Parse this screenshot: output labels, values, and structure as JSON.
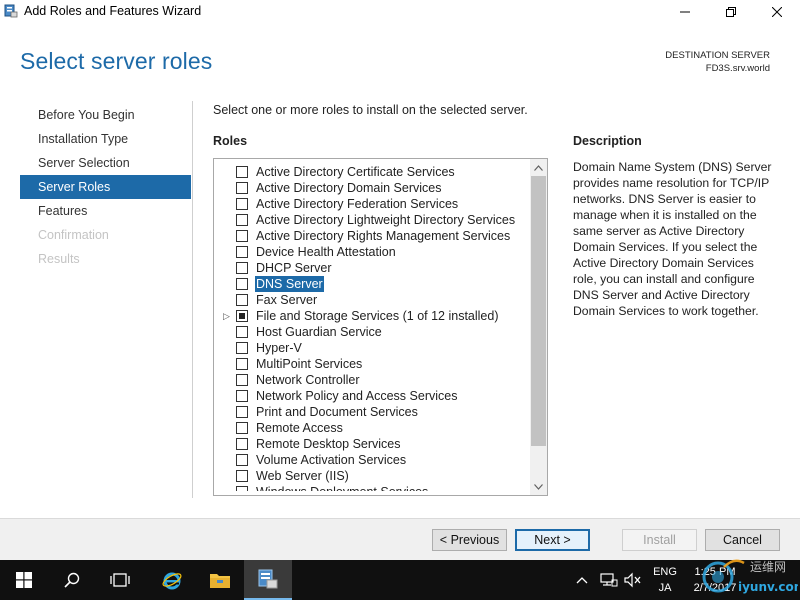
{
  "window": {
    "title": "Add Roles and Features Wizard",
    "controls": [
      "minimize-icon",
      "maximize-icon",
      "close-icon"
    ]
  },
  "header": {
    "page_title": "Select server roles",
    "destination_label": "DESTINATION SERVER",
    "destination_server": "FD3S.srv.world"
  },
  "nav": {
    "items": [
      {
        "label": "Before You Begin",
        "state": "normal"
      },
      {
        "label": "Installation Type",
        "state": "normal"
      },
      {
        "label": "Server Selection",
        "state": "normal"
      },
      {
        "label": "Server Roles",
        "state": "active"
      },
      {
        "label": "Features",
        "state": "normal"
      },
      {
        "label": "Confirmation",
        "state": "disabled"
      },
      {
        "label": "Results",
        "state": "disabled"
      }
    ]
  },
  "main": {
    "intro": "Select one or more roles to install on the selected server.",
    "roles_heading": "Roles",
    "roles": [
      {
        "label": "Active Directory Certificate Services",
        "checked": false
      },
      {
        "label": "Active Directory Domain Services",
        "checked": false
      },
      {
        "label": "Active Directory Federation Services",
        "checked": false
      },
      {
        "label": "Active Directory Lightweight Directory Services",
        "checked": false
      },
      {
        "label": "Active Directory Rights Management Services",
        "checked": false
      },
      {
        "label": "Device Health Attestation",
        "checked": false
      },
      {
        "label": "DHCP Server",
        "checked": false
      },
      {
        "label": "DNS Server",
        "checked": false,
        "selected": true
      },
      {
        "label": "Fax Server",
        "checked": false
      },
      {
        "label": "File and Storage Services (1 of 12 installed)",
        "checked": "partial",
        "expandable": true
      },
      {
        "label": "Host Guardian Service",
        "checked": false
      },
      {
        "label": "Hyper-V",
        "checked": false
      },
      {
        "label": "MultiPoint Services",
        "checked": false
      },
      {
        "label": "Network Controller",
        "checked": false
      },
      {
        "label": "Network Policy and Access Services",
        "checked": false
      },
      {
        "label": "Print and Document Services",
        "checked": false
      },
      {
        "label": "Remote Access",
        "checked": false
      },
      {
        "label": "Remote Desktop Services",
        "checked": false
      },
      {
        "label": "Volume Activation Services",
        "checked": false
      },
      {
        "label": "Web Server (IIS)",
        "checked": false
      },
      {
        "label": "Windows Deployment Services",
        "checked": false,
        "partially_visible": true
      }
    ],
    "description_heading": "Description",
    "description_text": "Domain Name System (DNS) Server provides name resolution for TCP/IP networks. DNS Server is easier to manage when it is installed on the same server as Active Directory Domain Services. If you select the Active Directory Domain Services role, you can install and configure DNS Server and Active Directory Domain Services to work together."
  },
  "footer": {
    "previous_label": "< Previous",
    "next_label": "Next >",
    "install_label": "Install",
    "cancel_label": "Cancel"
  },
  "taskbar": {
    "buttons": [
      "start-icon",
      "search-icon",
      "task-view-icon",
      "internet-explorer-icon",
      "file-explorer-icon",
      "server-manager-icon"
    ],
    "tray": {
      "language_top": "ENG",
      "language_bottom": "JA",
      "time": "1:25 PM",
      "date": "2/7/2017"
    }
  },
  "watermark": {
    "text_top": "运维网",
    "text_bottom": "iyunv.com"
  },
  "colors": {
    "accent": "#1d6aa8",
    "taskbar": "#101010",
    "footer": "#f0f0f0"
  }
}
